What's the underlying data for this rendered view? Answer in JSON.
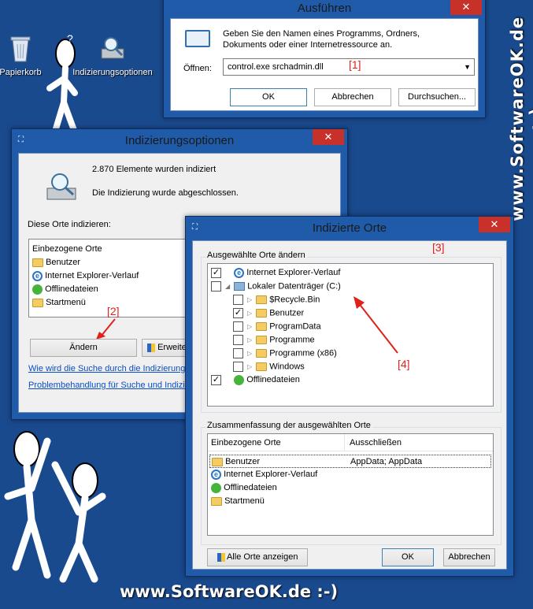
{
  "desktop": {
    "icons": [
      {
        "label": "Papierkorb",
        "icon": "recycle-bin-icon"
      },
      {
        "label": "Indizierungsoptionen",
        "icon": "indexing-options-icon"
      }
    ],
    "watermark_vertical": "www.SoftwareOK.de :-)",
    "watermark_horizontal": "www.SoftwareOK.de :-)"
  },
  "run_dialog": {
    "title": "Ausführen",
    "description": "Geben Sie den Namen eines Programms, Ordners, Dokuments oder einer Internetressource an.",
    "open_label": "Öffnen:",
    "open_value": "control.exe srchadmin.dll",
    "ok": "OK",
    "cancel": "Abbrechen",
    "browse": "Durchsuchen...",
    "annotation": "[1]"
  },
  "indexing_options": {
    "title": "Indizierungsoptionen",
    "status_count": "2.870 Elemente wurden indiziert",
    "status_text": "Die Indizierung wurde abgeschlossen.",
    "locations_label": "Diese Orte indizieren:",
    "list_header": "Einbezogene Orte",
    "list_items": [
      {
        "label": "Benutzer",
        "icon": "folder"
      },
      {
        "label": "Internet Explorer-Verlauf",
        "icon": "ie"
      },
      {
        "label": "Offlinedateien",
        "icon": "sync"
      },
      {
        "label": "Startmenü",
        "icon": "folder"
      }
    ],
    "modify_button": "Ändern",
    "advanced_button": "Erweiter",
    "link1": "Wie wird die Suche durch die Indizierung b",
    "link2": "Problembehandlung für Suche und Indizier",
    "annotation": "[2]"
  },
  "indexed_locations": {
    "title": "Indizierte Orte",
    "group1_label": "Ausgewählte Orte ändern",
    "tree": [
      {
        "label": "Internet Explorer-Verlauf",
        "checked": true,
        "indent": 0,
        "expander": "",
        "icon": "ie"
      },
      {
        "label": "Lokaler Datenträger (C:)",
        "checked": false,
        "indent": 0,
        "expander": "◢",
        "icon": "drive"
      },
      {
        "label": "$Recycle.Bin",
        "checked": false,
        "indent": 1,
        "expander": "▷",
        "icon": "folder"
      },
      {
        "label": "Benutzer",
        "checked": true,
        "indent": 1,
        "expander": "▷",
        "icon": "folder"
      },
      {
        "label": "ProgramData",
        "checked": false,
        "indent": 1,
        "expander": "▷",
        "icon": "folder"
      },
      {
        "label": "Programme",
        "checked": false,
        "indent": 1,
        "expander": "▷",
        "icon": "folder"
      },
      {
        "label": "Programme (x86)",
        "checked": false,
        "indent": 1,
        "expander": "▷",
        "icon": "folder"
      },
      {
        "label": "Windows",
        "checked": false,
        "indent": 1,
        "expander": "▷",
        "icon": "folder"
      },
      {
        "label": "Offlinedateien",
        "checked": true,
        "indent": 0,
        "expander": "",
        "icon": "sync"
      }
    ],
    "group2_label": "Zusammenfassung der ausgewählten Orte",
    "summary_headers": [
      "Einbezogene Orte",
      "Ausschließen"
    ],
    "summary_rows": [
      {
        "label": "Benutzer",
        "exclude": "AppData; AppData",
        "icon": "folder"
      },
      {
        "label": "Internet Explorer-Verlauf",
        "exclude": "",
        "icon": "ie"
      },
      {
        "label": "Offlinedateien",
        "exclude": "",
        "icon": "sync"
      },
      {
        "label": "Startmenü",
        "exclude": "",
        "icon": "folder"
      }
    ],
    "show_all_button": "Alle Orte anzeigen",
    "ok": "OK",
    "cancel": "Abbrechen",
    "annotation3": "[3]",
    "annotation4": "[4]"
  },
  "colors": {
    "desktop": "#1a4a8e",
    "window_frame": "#1f5ba8",
    "close": "#c7312a",
    "annotation": "#e0201b"
  }
}
